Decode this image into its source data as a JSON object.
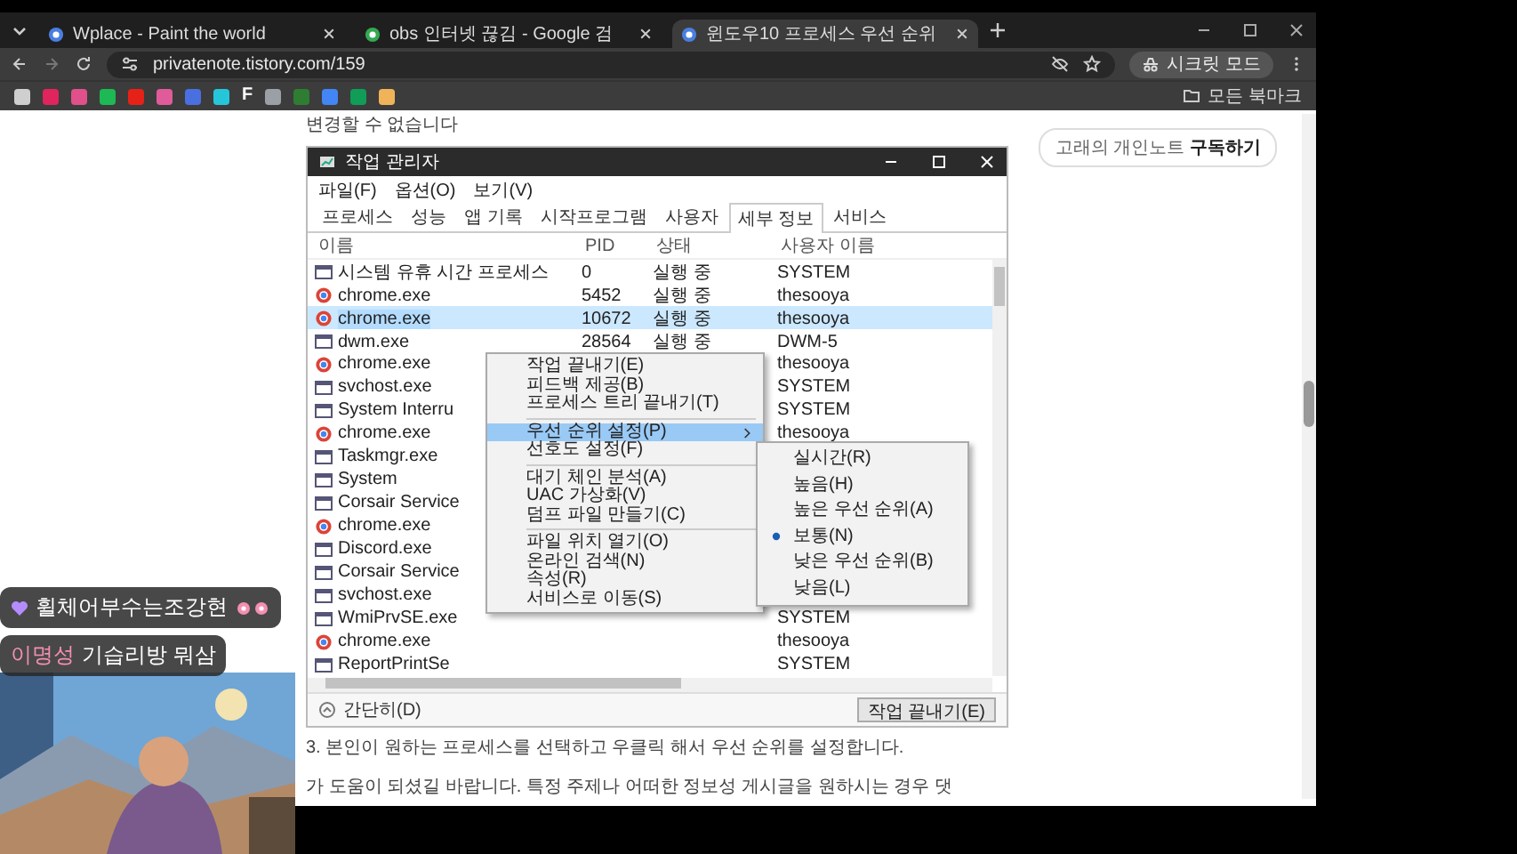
{
  "browser": {
    "tabs": [
      {
        "title": "Wplace - Paint the world",
        "selected": false
      },
      {
        "title": "obs 인터넷 끊김 - Google 검",
        "selected": false
      },
      {
        "title": "윈도우10 프로세스 우선 순위",
        "selected": true
      }
    ],
    "address": "privatenote.tistory.com/159",
    "incognito_label": "시크릿 모드",
    "bookmarks": [
      {
        "color": "#cfcfcf"
      },
      {
        "color": "#e0245e"
      },
      {
        "color": "#e0508a"
      },
      {
        "color": "#1db954"
      },
      {
        "color": "#e62117"
      },
      {
        "color": "#e05b9a"
      },
      {
        "color": "#4a6fe0"
      },
      {
        "color": "#26c6da"
      },
      {
        "color": "#ffffff",
        "label": "F"
      },
      {
        "color": "#9aa0a6"
      },
      {
        "color": "#2e7d32"
      },
      {
        "color": "#4285f4"
      },
      {
        "color": "#0f9d58"
      },
      {
        "color": "#f0b35a"
      }
    ],
    "all_bookmarks": "모든 북마크"
  },
  "post": {
    "intro_line": "변경할 수 없습니다",
    "subscribe": "고래의 개인노트 **구독하기**",
    "task_manager": {
      "title": "작업 관리자",
      "menu": [
        "파일(F)",
        "옵션(O)",
        "보기(V)"
      ],
      "tabs": [
        {
          "label": "프로세스",
          "selected": false
        },
        {
          "label": "성능",
          "selected": false
        },
        {
          "label": "앱 기록",
          "selected": false
        },
        {
          "label": "시작프로그램",
          "selected": false
        },
        {
          "label": "사용자",
          "selected": false
        },
        {
          "label": "세부 정보",
          "selected": true
        },
        {
          "label": "서비스",
          "selected": false
        }
      ],
      "columns": [
        "이름",
        "PID",
        "상태",
        "사용자 이름"
      ],
      "rows": [
        {
          "kind": "window",
          "name": "시스템 유휴 시간 프로세스",
          "pid": "0",
          "status": "실행 중",
          "user": "SYSTEM",
          "selected": false
        },
        {
          "kind": "browser",
          "name": "chrome.exe",
          "pid": "5452",
          "status": "실행 중",
          "user": "thesooya",
          "selected": false
        },
        {
          "kind": "browser",
          "name": "chrome.exe",
          "pid": "10672",
          "status": "실행 중",
          "user": "thesooya",
          "selected": true
        },
        {
          "kind": "window",
          "name": "dwm.exe",
          "pid": "28564",
          "status": "실행 중",
          "user": "DWM-5",
          "selected": false
        },
        {
          "kind": "browser",
          "name": "chrome.exe",
          "user": "thesooya",
          "selected": false
        },
        {
          "kind": "window",
          "name": "svchost.exe",
          "user": "SYSTEM",
          "selected": false
        },
        {
          "kind": "window",
          "name": "System Interru",
          "user": "SYSTEM",
          "selected": false
        },
        {
          "kind": "browser",
          "name": "chrome.exe",
          "user": "thesooya",
          "selected": false
        },
        {
          "kind": "window",
          "name": "Taskmgr.exe",
          "selected": false
        },
        {
          "kind": "window",
          "name": "System",
          "selected": false
        },
        {
          "kind": "window",
          "name": "Corsair Service",
          "selected": false
        },
        {
          "kind": "browser",
          "name": "chrome.exe",
          "selected": false
        },
        {
          "kind": "window",
          "name": "Discord.exe",
          "selected": false
        },
        {
          "kind": "window",
          "name": "Corsair Service",
          "selected": false
        },
        {
          "kind": "window",
          "name": "svchost.exe",
          "selected": false
        },
        {
          "kind": "window",
          "name": "WmiPrvSE.exe",
          "user": "SYSTEM",
          "selected": false
        },
        {
          "kind": "browser",
          "name": "chrome.exe",
          "user": "thesooya",
          "selected": false
        },
        {
          "kind": "window",
          "name": "ReportPrintSe",
          "user": "SYSTEM",
          "selected": false
        }
      ],
      "collapse": "간단히(D)",
      "end_task": "작업 끝내기(E)",
      "context_menu": [
        [
          {
            "label": "작업 끝내기(E)",
            "selected": false,
            "submenu": false
          },
          {
            "label": "피드백 제공(B)",
            "selected": false,
            "submenu": false
          },
          {
            "label": "프로세스 트리 끝내기(T)",
            "selected": false,
            "submenu": false
          }
        ],
        [
          {
            "label": "우선 순위 설정(P)",
            "selected": true,
            "submenu": true
          },
          {
            "label": "선호도 설정(F)",
            "selected": false,
            "submenu": false
          }
        ],
        [
          {
            "label": "대기 체인 분석(A)",
            "selected": false,
            "submenu": false
          },
          {
            "label": "UAC 가상화(V)",
            "selected": false,
            "submenu": false
          },
          {
            "label": "덤프 파일 만들기(C)",
            "selected": false,
            "submenu": false
          }
        ],
        [
          {
            "label": "파일 위치 열기(O)",
            "selected": false,
            "submenu": false
          },
          {
            "label": "온라인 검색(N)",
            "selected": false,
            "submenu": false
          },
          {
            "label": "속성(R)",
            "selected": false,
            "submenu": false
          },
          {
            "label": "서비스로 이동(S)",
            "selected": false,
            "submenu": false
          }
        ]
      ],
      "submenu": [
        {
          "label": "실시간(R)",
          "checked": false
        },
        {
          "label": "높음(H)",
          "checked": false
        },
        {
          "label": "높은 우선 순위(A)",
          "checked": false
        },
        {
          "label": "보통(N)",
          "checked": true
        },
        {
          "label": "낮은 우선 순위(B)",
          "checked": false
        },
        {
          "label": "낮음(L)",
          "checked": false
        }
      ]
    },
    "step_3": "3. 본인이 원하는 프로세스를 선택하고 우클릭 해서 우선 순위를 설정합니다.",
    "closing_line": "가 도움이 되셨길 바랍니다. 특정 주제나 어떠한 정보성 게시글을 원하시는 경우 댓"
  },
  "chat": [
    {
      "kind": "badge",
      "text": "휠체어부수는조강현"
    },
    {
      "kind": "message",
      "name": "이명성",
      "text": "기습리방 뭐삼"
    }
  ]
}
